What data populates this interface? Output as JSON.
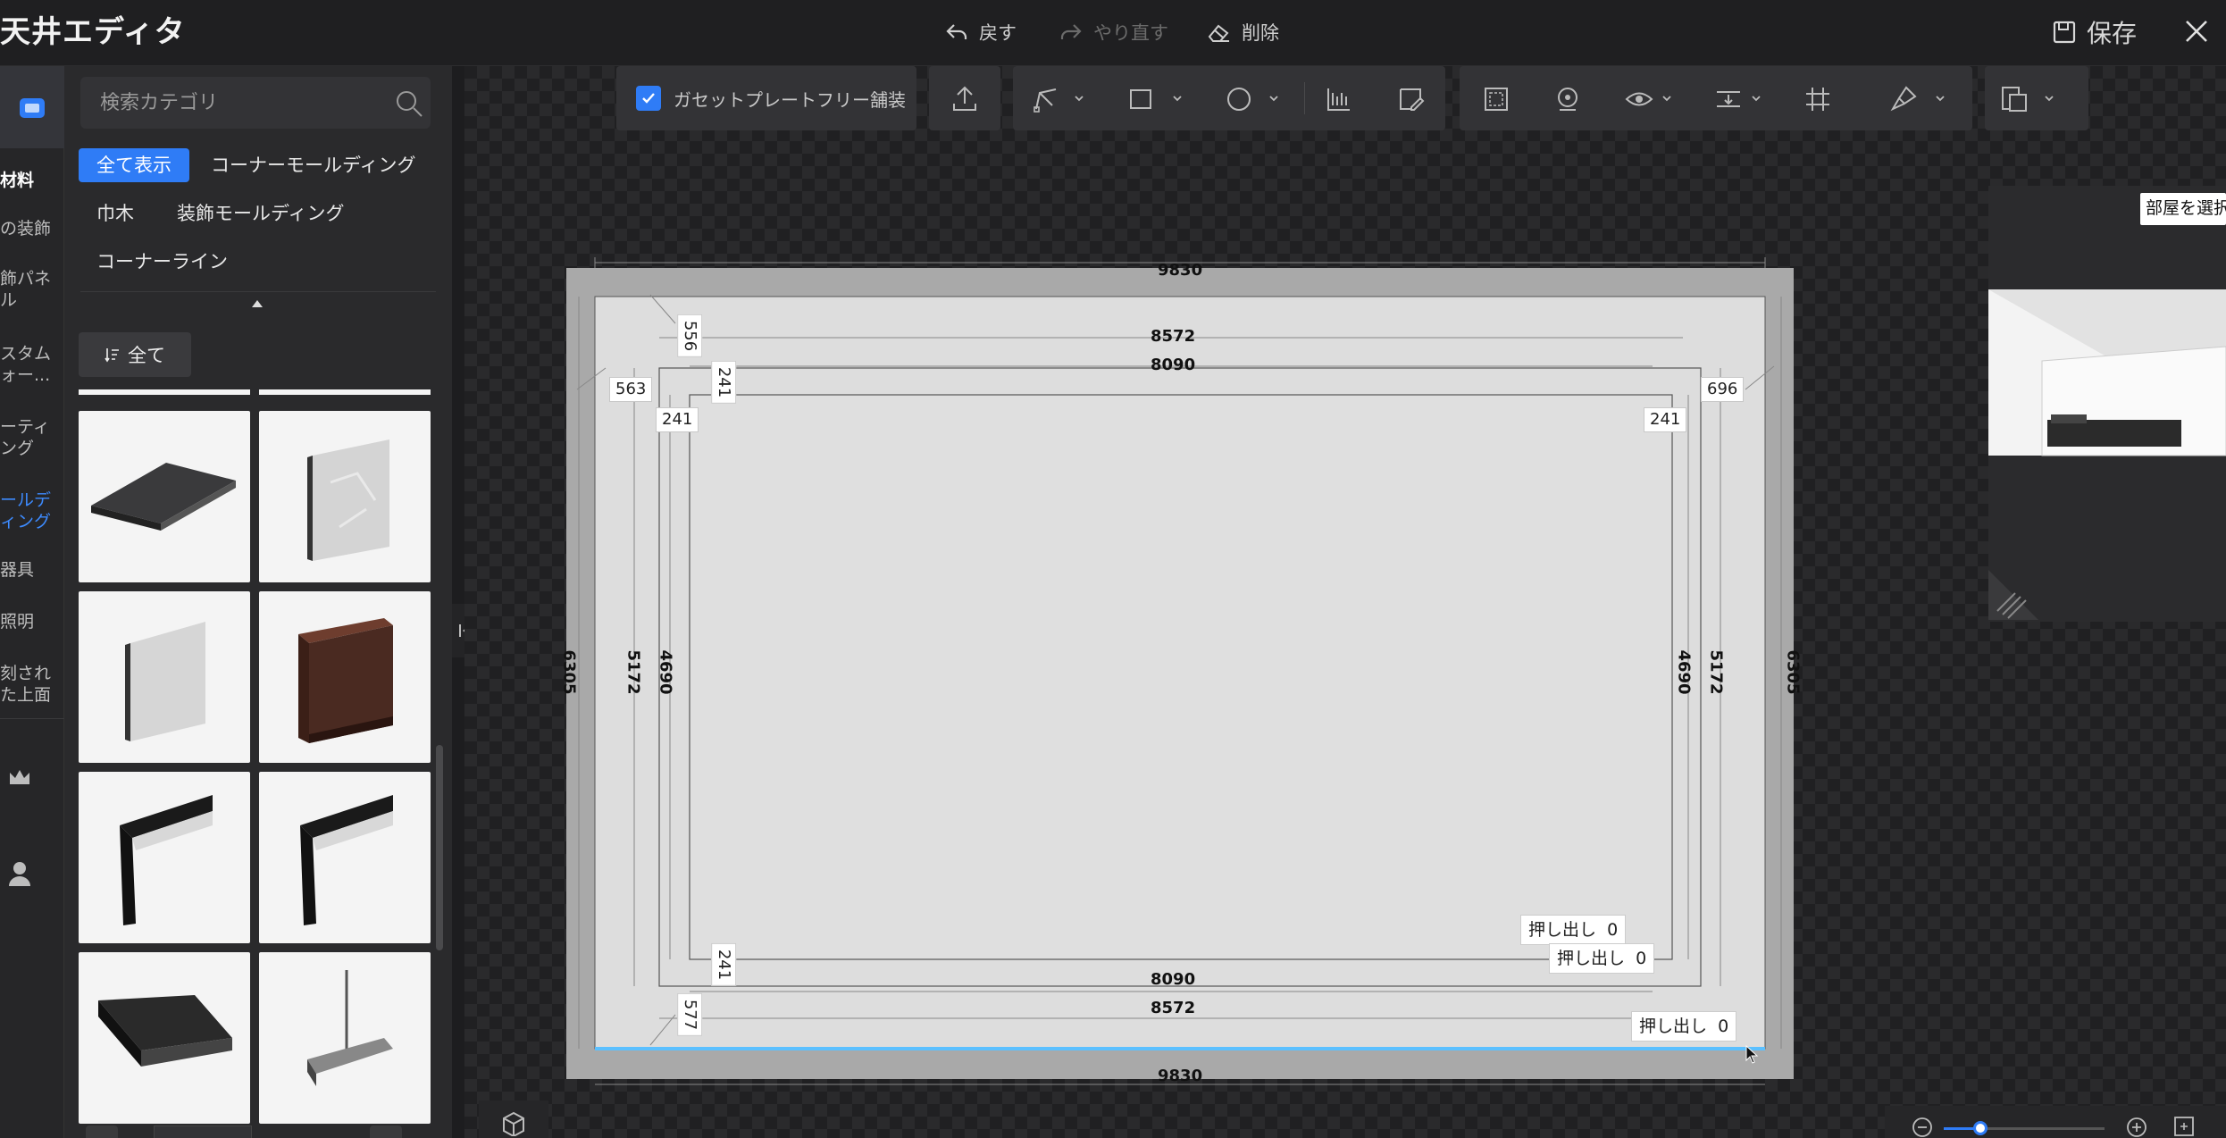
{
  "app": {
    "title": "天井エディタ",
    "undo_label": "戻す",
    "redo_label": "やり直す",
    "delete_label": "削除",
    "save_label": "保存"
  },
  "rail": {
    "items": [
      {
        "label": "材料",
        "state": "bold"
      },
      {
        "label": "の装飾"
      },
      {
        "label": "飾パネ"
      },
      {
        "label": "ル"
      },
      {
        "label": "スタム"
      },
      {
        "label": "ォー..."
      },
      {
        "label": "ーティ"
      },
      {
        "label": "ング"
      },
      {
        "label": "ールデ",
        "state": "active"
      },
      {
        "label": "ィング",
        "state": "active"
      },
      {
        "label": "器具"
      },
      {
        "label": "照明"
      },
      {
        "label": "刻され"
      },
      {
        "label": "た上面"
      }
    ],
    "icons": [
      "crown-icon",
      "user-icon"
    ]
  },
  "panel": {
    "search_placeholder": "検索カテゴリ",
    "categories": [
      {
        "label": "全て表示",
        "active": true
      },
      {
        "label": "コーナーモールディング"
      },
      {
        "label": "巾木"
      },
      {
        "label": "装飾モールディング"
      },
      {
        "label": "コーナーライン"
      }
    ],
    "sort_label": "全て",
    "tiles": [
      "flat-dark-board",
      "stone-slab",
      "stone-slab-small",
      "brown-channel",
      "dark-bar-profile",
      "dark-bar-profile",
      "box-channel",
      "hanging-rail"
    ]
  },
  "toolbar": {
    "gasset_label": "ガセットプレートフリー舗装",
    "gasset_checked": true
  },
  "room": {
    "outer_width": "9830",
    "outer_height": "6305",
    "mid_width": "8572",
    "mid_height": "5172",
    "inner_width": "8090",
    "inner_height": "4690",
    "offset_top": "556",
    "offset_bottom": "577",
    "offset_left": "563",
    "offset_right": "696",
    "gap": "241",
    "extrude_label": "押し出し",
    "extrude_value": "0"
  },
  "preview": {
    "room_select_label": "部屋を選択"
  },
  "zoom": {
    "level": 0.23
  },
  "colors": {
    "accent": "#2f7cf6",
    "background": "#1d1d1f"
  }
}
